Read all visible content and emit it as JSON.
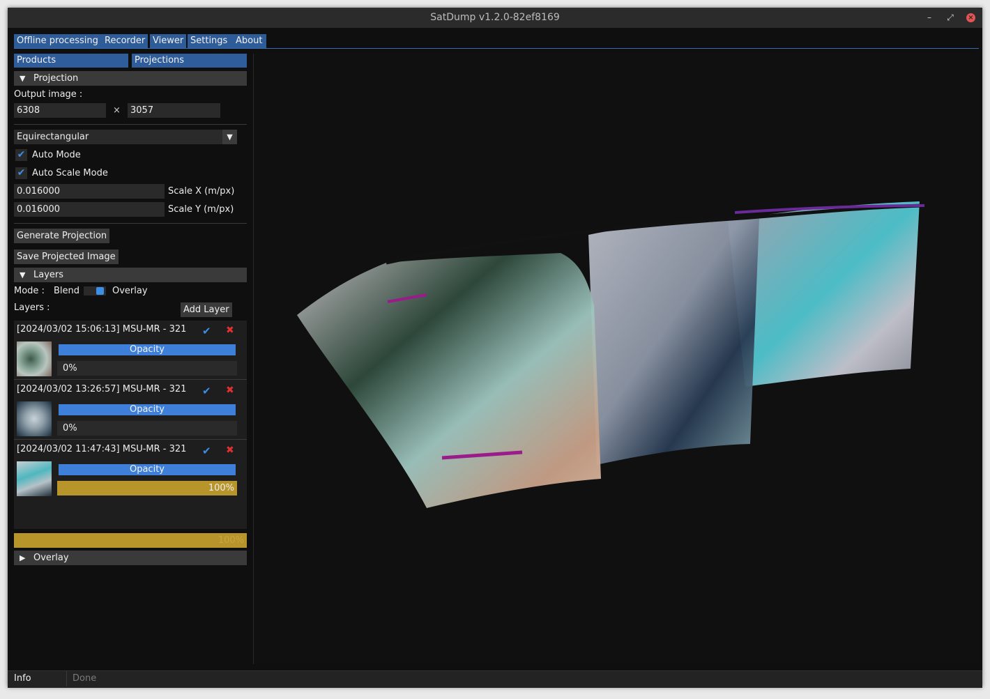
{
  "window": {
    "title": "SatDump v1.2.0-82ef8169"
  },
  "tabs": [
    "Offline processing",
    "Recorder",
    "Viewer",
    "Settings",
    "About"
  ],
  "subtabs": [
    "Products",
    "Projections"
  ],
  "projection": {
    "header": "Projection",
    "output_label": "Output image :",
    "width": "6308",
    "times": "×",
    "height": "3057",
    "type": "Equirectangular",
    "auto_mode": "Auto Mode",
    "auto_scale_mode": "Auto Scale Mode",
    "scale_x_value": "0.016000",
    "scale_x_label": "Scale X (m/px)",
    "scale_y_value": "0.016000",
    "scale_y_label": "Scale Y (m/px)",
    "generate_btn": "Generate Projection",
    "save_btn": "Save Projected Image"
  },
  "layers": {
    "header": "Layers",
    "mode_label": "Mode :",
    "mode_blend": "Blend",
    "mode_overlay": "Overlay",
    "layers_label": "Layers :",
    "add_btn": "Add Layer",
    "items": [
      {
        "title": "[2024/03/02 15:06:13] MSU-MR - 321",
        "opacity_label": "Opacity",
        "progress_text": "0%",
        "progress": 0
      },
      {
        "title": "[2024/03/02 13:26:57] MSU-MR - 321",
        "opacity_label": "Opacity",
        "progress_text": "0%",
        "progress": 0
      },
      {
        "title": "[2024/03/02 11:47:43] MSU-MR - 321",
        "opacity_label": "Opacity",
        "progress_text": "100%",
        "progress": 1.0
      }
    ],
    "total_progress_text": "100%",
    "total_progress": 1.0
  },
  "overlay": {
    "header": "Overlay"
  },
  "status": {
    "label": "Info",
    "text": "Done"
  },
  "colors": {
    "accent": "#2f5d9c",
    "progress": "#b8952a",
    "check": "#3d8fe6",
    "delete": "#e23030"
  }
}
